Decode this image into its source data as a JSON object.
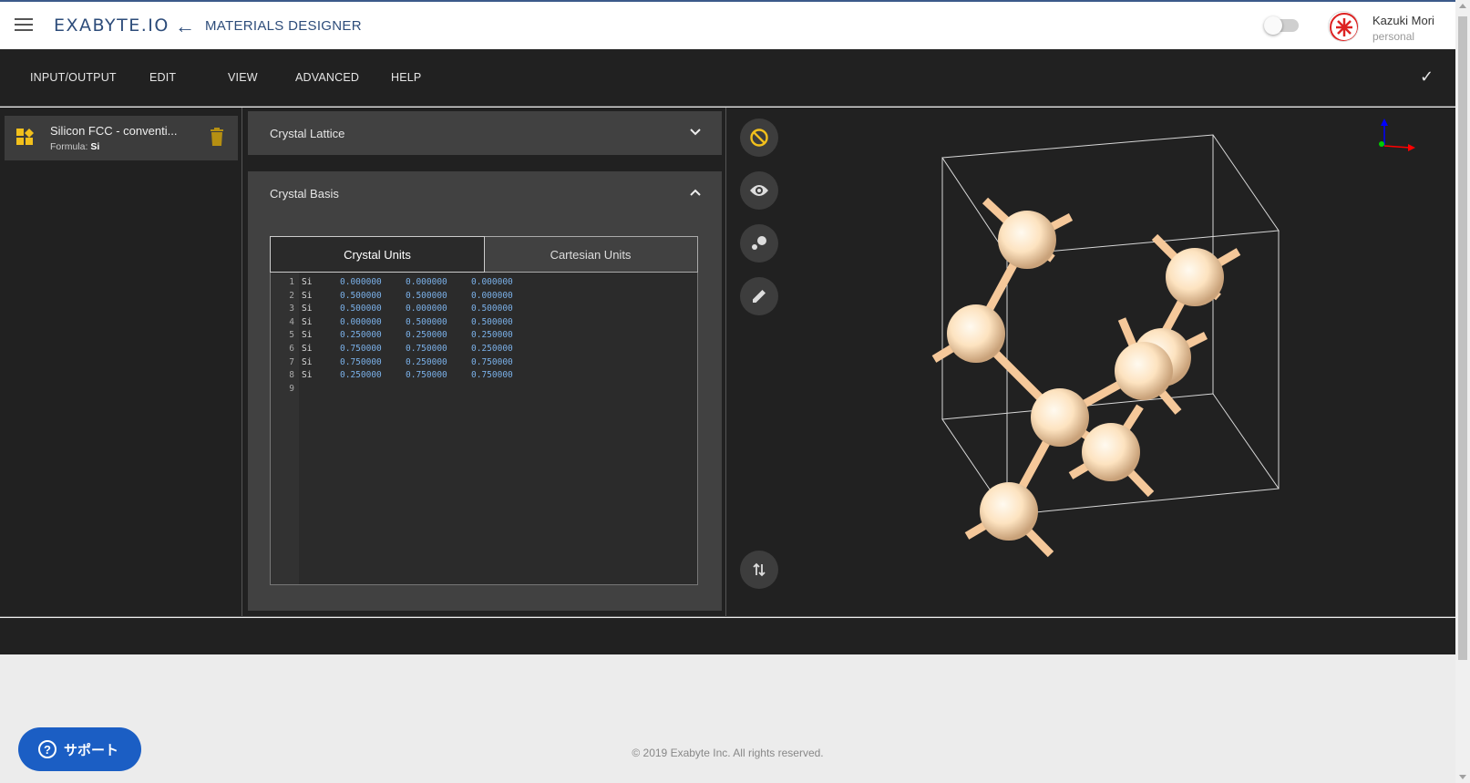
{
  "header": {
    "logo_text": "EXABYTE.IO",
    "app_title": "MATERIALS DESIGNER",
    "user": {
      "name": "Kazuki Mori",
      "role": "personal"
    }
  },
  "menu": {
    "items": [
      "INPUT/OUTPUT",
      "EDIT",
      "VIEW",
      "ADVANCED",
      "HELP"
    ]
  },
  "materials": [
    {
      "name": "Silicon FCC - conventi...",
      "formula_label": "Formula:",
      "formula": "Si"
    }
  ],
  "panels": {
    "lattice_title": "Crystal Lattice",
    "basis_title": "Crystal Basis",
    "tabs": [
      "Crystal Units",
      "Cartesian Units"
    ],
    "active_tab": "Crystal Units"
  },
  "basis_lines": [
    {
      "n": "1",
      "el": "Si",
      "x": "0.000000",
      "y": "0.000000",
      "z": "0.000000"
    },
    {
      "n": "2",
      "el": "Si",
      "x": "0.500000",
      "y": "0.500000",
      "z": "0.000000"
    },
    {
      "n": "3",
      "el": "Si",
      "x": "0.500000",
      "y": "0.000000",
      "z": "0.500000"
    },
    {
      "n": "4",
      "el": "Si",
      "x": "0.000000",
      "y": "0.500000",
      "z": "0.500000"
    },
    {
      "n": "5",
      "el": "Si",
      "x": "0.250000",
      "y": "0.250000",
      "z": "0.250000"
    },
    {
      "n": "6",
      "el": "Si",
      "x": "0.750000",
      "y": "0.750000",
      "z": "0.250000"
    },
    {
      "n": "7",
      "el": "Si",
      "x": "0.750000",
      "y": "0.250000",
      "z": "0.750000"
    },
    {
      "n": "8",
      "el": "Si",
      "x": "0.250000",
      "y": "0.750000",
      "z": "0.750000"
    },
    {
      "n": "9",
      "el": "",
      "x": "",
      "y": "",
      "z": ""
    }
  ],
  "viewer_tools": [
    "ban-icon",
    "eye-icon",
    "atoms-icon",
    "pencil-icon",
    "swap-vertical-icon"
  ],
  "footer": {
    "copyright": "© 2019 Exabyte Inc. All rights reserved.",
    "support_label": "サポート"
  },
  "colors": {
    "brand": "#2d4c7a",
    "accent_yellow": "#f2c01c",
    "atom": "#fde3c0",
    "bond": "#f5c89a",
    "support_blue": "#1b5ec4"
  }
}
